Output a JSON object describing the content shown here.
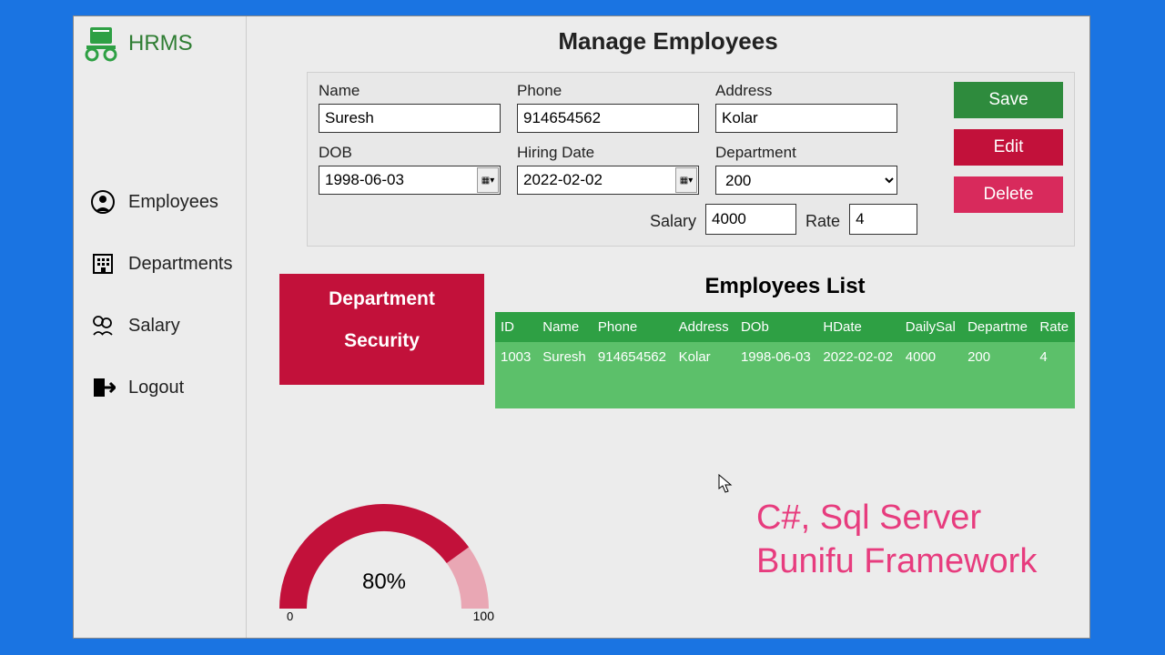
{
  "app": {
    "name": "HRMS"
  },
  "sidebar": {
    "items": [
      {
        "label": "Employees"
      },
      {
        "label": "Departments"
      },
      {
        "label": "Salary"
      },
      {
        "label": "Logout"
      }
    ]
  },
  "page": {
    "title": "Manage Employees"
  },
  "form": {
    "name_label": "Name",
    "name_value": "Suresh",
    "phone_label": "Phone",
    "phone_value": "914654562",
    "address_label": "Address",
    "address_value": "Kolar",
    "dob_label": "DOB",
    "dob_value": "1998-06-03",
    "hiring_label": "Hiring Date",
    "hiring_value": "2022-02-02",
    "dept_label": "Department",
    "dept_value": "200",
    "salary_label": "Salary",
    "salary_value": "4000",
    "rate_label": "Rate",
    "rate_value": "4"
  },
  "buttons": {
    "save": "Save",
    "edit": "Edit",
    "delete": "Delete"
  },
  "dept_card": {
    "line1": "Department",
    "line2": "Security"
  },
  "list": {
    "title": "Employees List",
    "headers": [
      "ID",
      "Name",
      "Phone",
      "Address",
      "DOb",
      "HDate",
      "DailySal",
      "Departme",
      "Rate"
    ],
    "rows": [
      {
        "id": "1003",
        "name": "Suresh",
        "phone": "914654562",
        "address": "Kolar",
        "dob": "1998-06-03",
        "hdate": "2022-02-02",
        "dailysal": "4000",
        "dept": "200",
        "rate": "4"
      }
    ]
  },
  "gauge": {
    "value_text": "80%",
    "min": "0",
    "max": "100",
    "fill_pct": 80
  },
  "tech": {
    "line1": "C#, Sql Server",
    "line2": "Bunifu Framework"
  },
  "chart_data": {
    "type": "gauge",
    "title": "",
    "value": 80,
    "min": 0,
    "max": 100,
    "unit": "%"
  }
}
